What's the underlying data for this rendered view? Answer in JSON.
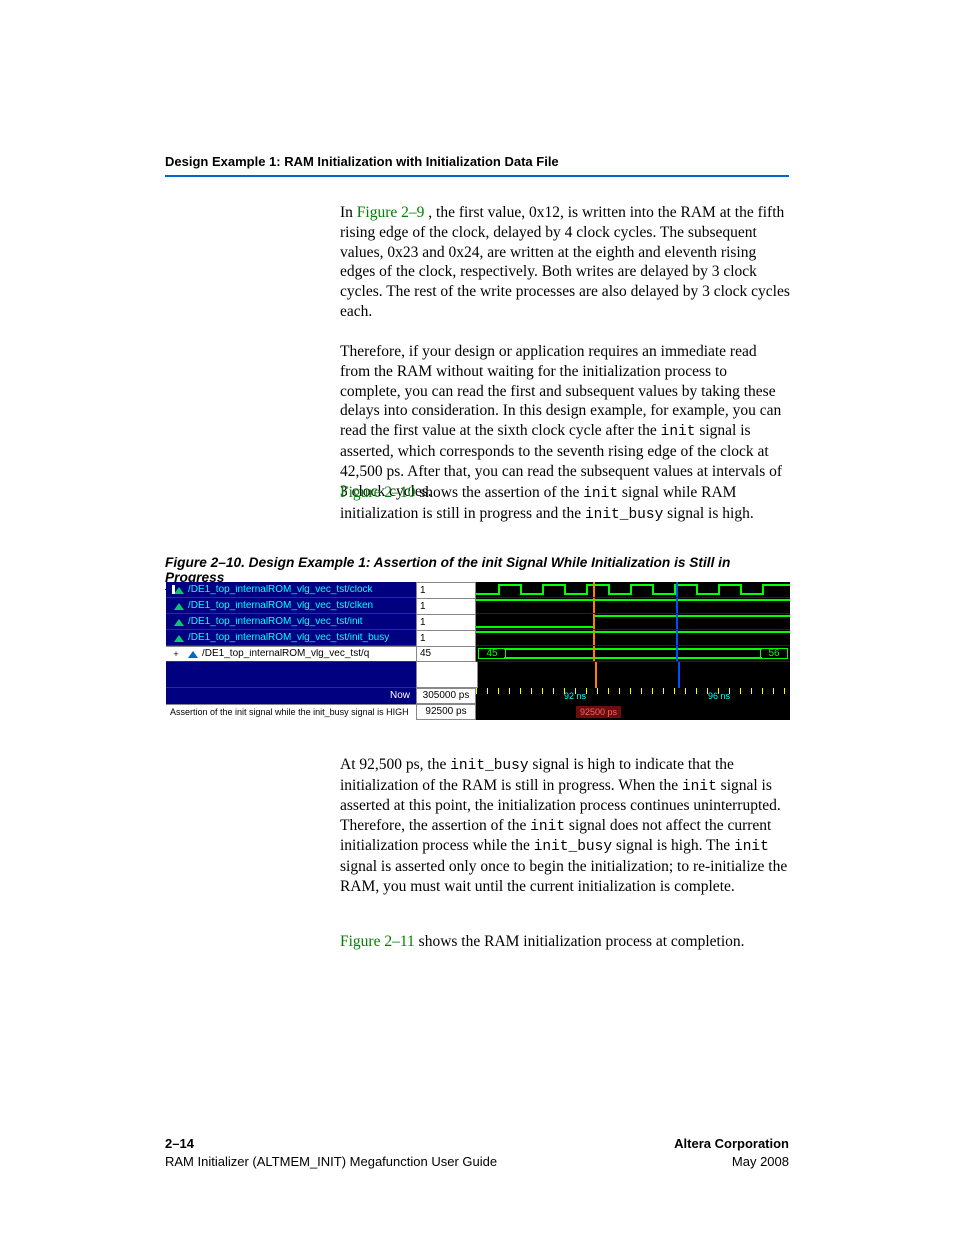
{
  "header": {
    "section_title": "Design Example 1: RAM Initialization with Initialization Data File"
  },
  "links": {
    "fig29": "Figure 2–9",
    "fig210": "Figure 2–10",
    "fig211": "Figure 2–11"
  },
  "mono": {
    "init": "init",
    "init_busy": "init_busy"
  },
  "para1": {
    "a": "In ",
    "b": " , the first value, 0x12,  is written into the RAM at the fifth rising edge of the clock, delayed by 4 clock cycles. The subsequent values, 0x23 and 0x24, are written at the eighth and eleventh rising edges of the clock, respectively. Both writes are delayed by 3 clock cycles. The rest of the write processes are also delayed by 3 clock cycles each."
  },
  "para2": {
    "a": "Therefore, if your design or application requires an immediate read from the RAM without waiting for the initialization process to complete, you can read the first and subsequent values by taking these delays into consideration. In this design example, for example, you can read the first value at the sixth clock cycle after the ",
    "b": " signal is asserted, which corresponds to the seventh rising edge of the clock at 42,500 ps. After that, you can read the subsequent values at intervals of 3 clock cycles."
  },
  "para3": {
    "a": " shows the assertion of the ",
    "b": " signal while RAM initialization is still in progress and the ",
    "c": " signal is high."
  },
  "figcap": "Figure 2–10. Design Example 1: Assertion of the init Signal While Initialization is Still in Progress",
  "wave": {
    "signals": [
      {
        "name": "/DE1_top_internalROM_vlg_vec_tst/clock",
        "val": "1"
      },
      {
        "name": "/DE1_top_internalROM_vlg_vec_tst/clken",
        "val": "1"
      },
      {
        "name": "/DE1_top_internalROM_vlg_vec_tst/init",
        "val": "1"
      },
      {
        "name": "/DE1_top_internalROM_vlg_vec_tst/init_busy",
        "val": "1"
      }
    ],
    "q": {
      "name": "/DE1_top_internalROM_vlg_vec_tst/q",
      "val": "45",
      "left_box": "45",
      "right_box": "56"
    },
    "now_label": "Now",
    "now_val": "305000 ps",
    "tick_92": "92 ns",
    "tick_96": "96 ns",
    "cursor_label": "Assertion of the init signal while the init_busy signal is HIGH",
    "cursor_val": "92500 ps",
    "cursor_pill": "92500 ps"
  },
  "para4": {
    "a": "At 92,500 ps, the ",
    "b": " signal is high to indicate that the initialization of the RAM is still in progress. When the ",
    "c": " signal is asserted at this point, the initialization process continues uninterrupted. Therefore, the assertion of the ",
    "d": " signal does not affect the current initialization process while the ",
    "e": " signal is high. The ",
    "f": " signal is asserted only once to begin the initialization; to re-initialize the RAM, you must wait until the current initialization is complete."
  },
  "para5": {
    "a": " shows the RAM initialization process at completion."
  },
  "footer": {
    "page": "2–14",
    "doc": "RAM Initializer (ALTMEM_INIT) Megafunction User Guide",
    "corp": "Altera Corporation",
    "date": "May 2008"
  }
}
